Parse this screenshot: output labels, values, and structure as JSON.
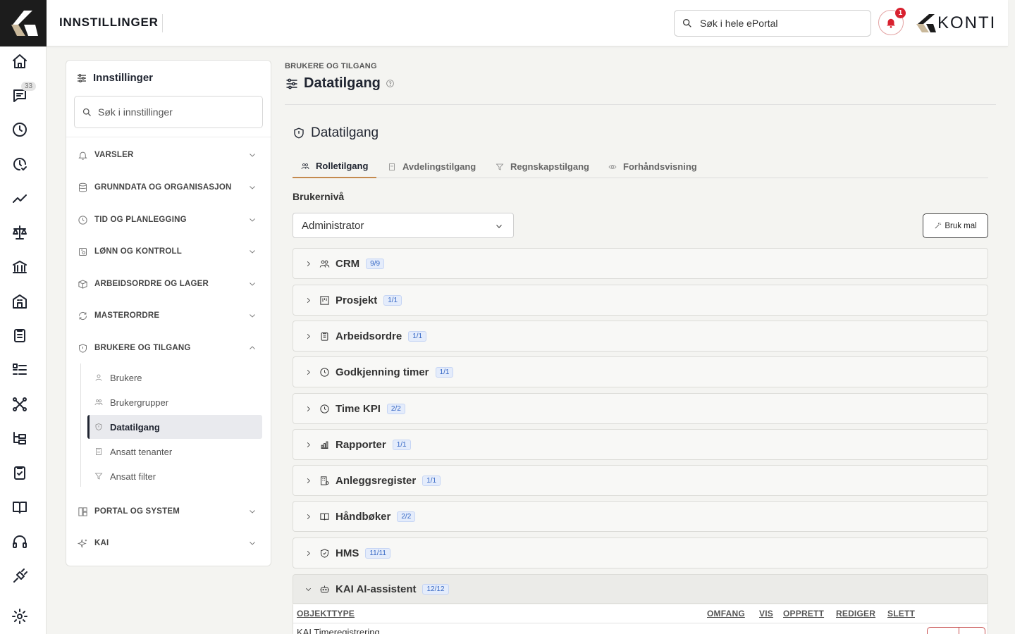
{
  "header": {
    "title": "INNSTILLINGER",
    "search_placeholder": "Søk i hele ePortal",
    "notification_count": "1",
    "brand_text": "KONTI"
  },
  "rail": {
    "messages_badge": "33",
    "icons": [
      "home-icon",
      "chat-icon",
      "clock-icon",
      "clock-check-icon",
      "trend-icon",
      "scale-icon",
      "bank-icon",
      "building-icon",
      "clipboard-icon",
      "list-icon",
      "network-icon",
      "tree-icon",
      "clipboard-check-icon",
      "book-icon",
      "headset-icon",
      "plug-icon",
      "gear-icon"
    ]
  },
  "settings_panel": {
    "title": "Innstillinger",
    "search_placeholder": "Søk i innstillinger",
    "categories": [
      {
        "label": "VARSLER"
      },
      {
        "label": "GRUNNDATA OG ORGANISASJON"
      },
      {
        "label": "TID OG PLANLEGGING"
      },
      {
        "label": "LØNN OG KONTROLL"
      },
      {
        "label": "ARBEIDSORDRE OG LAGER"
      },
      {
        "label": "MASTERORDRE"
      },
      {
        "label": "BRUKERE OG TILGANG"
      },
      {
        "label": "PORTAL OG SYSTEM"
      },
      {
        "label": "KAI"
      }
    ],
    "sub_items": [
      {
        "label": "Brukere"
      },
      {
        "label": "Brukergrupper"
      },
      {
        "label": "Datatilgang"
      },
      {
        "label": "Ansatt tenanter"
      },
      {
        "label": "Ansatt filter"
      }
    ]
  },
  "main": {
    "breadcrumb": "BRUKERE OG TILGANG",
    "page_title": "Datatilgang",
    "section_title": "Datatilgang",
    "tabs": [
      {
        "label": "Rolletilgang"
      },
      {
        "label": "Avdelingstilgang"
      },
      {
        "label": "Regnskapstilgang"
      },
      {
        "label": "Forhåndsvisning"
      }
    ],
    "user_level_label": "Brukernivå",
    "user_level_value": "Administrator",
    "use_template_label": "Bruk mal",
    "modules": [
      {
        "name": "CRM",
        "count": "9/9"
      },
      {
        "name": "Prosjekt",
        "count": "1/1"
      },
      {
        "name": "Arbeidsordre",
        "count": "1/1"
      },
      {
        "name": "Godkjenning timer",
        "count": "1/1"
      },
      {
        "name": "Time KPI",
        "count": "2/2"
      },
      {
        "name": "Rapporter",
        "count": "1/1"
      },
      {
        "name": "Anleggsregister",
        "count": "1/1"
      },
      {
        "name": "Håndbøker",
        "count": "2/2"
      },
      {
        "name": "HMS",
        "count": "11/11"
      },
      {
        "name": "KAI AI-assistent",
        "count": "12/12"
      }
    ],
    "table": {
      "headers": {
        "object_type": "OBJEKTTYPE",
        "scope": "OMFANG",
        "view": "VIS",
        "create": "OPPRETT",
        "edit": "REDIGER",
        "delete": "SLETT"
      },
      "rows": [
        {
          "object_type": "KAI Timeregistrering"
        }
      ]
    }
  },
  "colors": {
    "accent_tab": "#c48a4e",
    "notification": "#d8212f",
    "count_badge": "#3567c4"
  }
}
